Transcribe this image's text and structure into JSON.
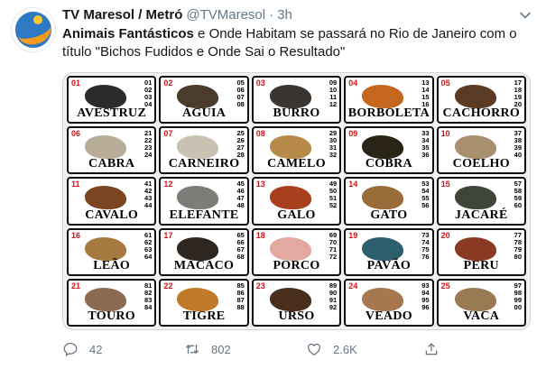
{
  "tweet": {
    "display_name": "TV Maresol / Metró",
    "handle": "@TVMaresol",
    "separator": "·",
    "time": "3h",
    "text_bold": "Animais Fantásticos",
    "text_rest": " e Onde Habitam se passará no Rio de Janeiro com o título \"Bichos Fudidos e Onde Sai o Resultado\""
  },
  "grid": [
    {
      "num": "01",
      "nums": [
        "01",
        "02",
        "03",
        "04"
      ],
      "name": "AVESTRUZ",
      "color": "#2b2b2b"
    },
    {
      "num": "02",
      "nums": [
        "05",
        "06",
        "07",
        "08"
      ],
      "name": "ÁGUIA",
      "color": "#4a3b2c"
    },
    {
      "num": "03",
      "nums": [
        "09",
        "10",
        "11",
        "12"
      ],
      "name": "BURRO",
      "color": "#3a3530"
    },
    {
      "num": "04",
      "nums": [
        "13",
        "14",
        "15",
        "16"
      ],
      "name": "BORBOLETA",
      "color": "#c4661e"
    },
    {
      "num": "05",
      "nums": [
        "17",
        "18",
        "19",
        "20"
      ],
      "name": "CACHORRO",
      "color": "#5a3a22"
    },
    {
      "num": "06",
      "nums": [
        "21",
        "22",
        "23",
        "24"
      ],
      "name": "CABRA",
      "color": "#b8ad98"
    },
    {
      "num": "07",
      "nums": [
        "25",
        "26",
        "27",
        "28"
      ],
      "name": "CARNEIRO",
      "color": "#c9c2b2"
    },
    {
      "num": "08",
      "nums": [
        "29",
        "30",
        "31",
        "32"
      ],
      "name": "CAMELO",
      "color": "#b88a4a"
    },
    {
      "num": "09",
      "nums": [
        "33",
        "34",
        "35",
        "36"
      ],
      "name": "COBRA",
      "color": "#2a2418"
    },
    {
      "num": "10",
      "nums": [
        "37",
        "38",
        "39",
        "40"
      ],
      "name": "COELHO",
      "color": "#a88f70"
    },
    {
      "num": "11",
      "nums": [
        "41",
        "42",
        "43",
        "44"
      ],
      "name": "CAVALO",
      "color": "#7a4520"
    },
    {
      "num": "12",
      "nums": [
        "45",
        "46",
        "47",
        "48"
      ],
      "name": "ELEFANTE",
      "color": "#7c7c78"
    },
    {
      "num": "13",
      "nums": [
        "49",
        "50",
        "51",
        "52"
      ],
      "name": "GALO",
      "color": "#a8401e"
    },
    {
      "num": "14",
      "nums": [
        "53",
        "54",
        "55",
        "56"
      ],
      "name": "GATO",
      "color": "#9a6c3a"
    },
    {
      "num": "15",
      "nums": [
        "57",
        "58",
        "59",
        "60"
      ],
      "name": "JACARÉ",
      "color": "#3f4538"
    },
    {
      "num": "16",
      "nums": [
        "61",
        "62",
        "63",
        "64"
      ],
      "name": "LEÃO",
      "color": "#a77a40"
    },
    {
      "num": "17",
      "nums": [
        "65",
        "66",
        "67",
        "68"
      ],
      "name": "MACACO",
      "color": "#2e2620"
    },
    {
      "num": "18",
      "nums": [
        "69",
        "70",
        "71",
        "72"
      ],
      "name": "PORCO",
      "color": "#e3a9a0"
    },
    {
      "num": "19",
      "nums": [
        "73",
        "74",
        "75",
        "76"
      ],
      "name": "PAVÃO",
      "color": "#2c5f6e"
    },
    {
      "num": "20",
      "nums": [
        "77",
        "78",
        "79",
        "80"
      ],
      "name": "PERU",
      "color": "#8a3a22"
    },
    {
      "num": "21",
      "nums": [
        "81",
        "82",
        "83",
        "84"
      ],
      "name": "TOURO",
      "color": "#8c6a52"
    },
    {
      "num": "22",
      "nums": [
        "85",
        "86",
        "87",
        "88"
      ],
      "name": "TIGRE",
      "color": "#c07a2a"
    },
    {
      "num": "23",
      "nums": [
        "89",
        "90",
        "91",
        "92"
      ],
      "name": "URSO",
      "color": "#4a2e1c"
    },
    {
      "num": "24",
      "nums": [
        "93",
        "94",
        "95",
        "96"
      ],
      "name": "VEADO",
      "color": "#a77850"
    },
    {
      "num": "25",
      "nums": [
        "97",
        "98",
        "99",
        "00"
      ],
      "name": "VACA",
      "color": "#9a7a52"
    }
  ],
  "actions": {
    "reply_count": "42",
    "retweet_count": "802",
    "like_count": "2.6K"
  },
  "icons": {
    "reply": "reply-icon",
    "retweet": "retweet-icon",
    "like": "heart-icon",
    "share": "share-icon",
    "caret": "chevron-down-icon"
  },
  "colors": {
    "text_secondary": "#657786",
    "grid_number": "#d0141a"
  }
}
